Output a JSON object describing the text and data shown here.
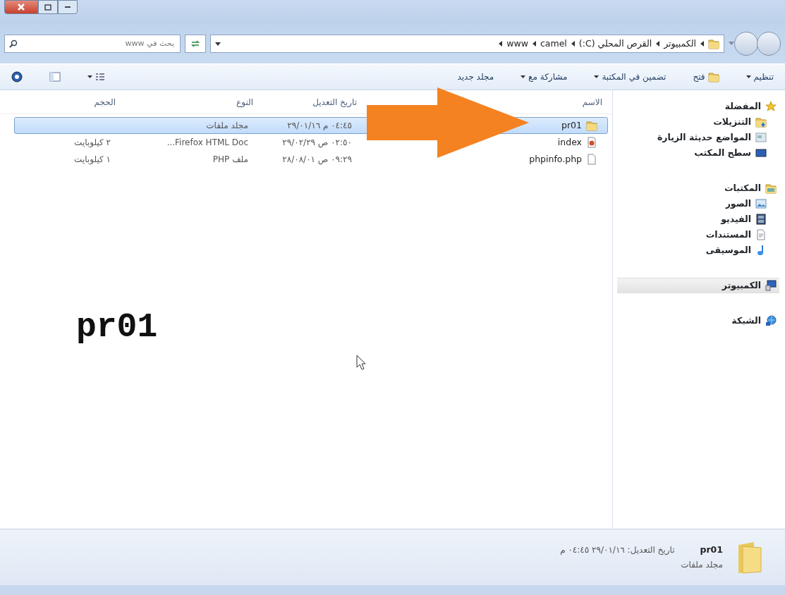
{
  "address": {
    "segments": [
      "الكمبيوتر",
      "القرص المحلي (C:)",
      "camel",
      "www"
    ]
  },
  "search": {
    "placeholder": "بحث في www"
  },
  "toolbar": [
    {
      "label": "تنظيم",
      "dropdown": true,
      "kind": "text"
    },
    {
      "label": "فتح",
      "dropdown": false,
      "kind": "folder"
    },
    {
      "label": "تضمين في المكتبة",
      "dropdown": true,
      "kind": "text"
    },
    {
      "label": "مشاركة مع",
      "dropdown": true,
      "kind": "text"
    },
    {
      "label": "مجلد جديد",
      "dropdown": false,
      "kind": "text"
    }
  ],
  "sidebar": [
    {
      "items": [
        {
          "label": "المفضلة",
          "kind": "star",
          "selected": false,
          "children": [
            {
              "label": "التنزيلات",
              "kind": "download",
              "selected": false
            },
            {
              "label": "المواضع حديثة الزيارة",
              "kind": "recent",
              "selected": false
            },
            {
              "label": "سطح المكتب",
              "kind": "desktop",
              "selected": false
            }
          ]
        }
      ]
    },
    {
      "items": [
        {
          "label": "المكتبات",
          "kind": "library",
          "selected": false,
          "children": [
            {
              "label": "الصور",
              "kind": "pictures",
              "selected": false
            },
            {
              "label": "الفيديو",
              "kind": "video",
              "selected": false
            },
            {
              "label": "المستندات",
              "kind": "documents",
              "selected": false
            },
            {
              "label": "الموسيقى",
              "kind": "music",
              "selected": false
            }
          ]
        }
      ]
    },
    {
      "items": [
        {
          "label": "الكمبيوتر",
          "kind": "computer",
          "selected": true
        }
      ]
    },
    {
      "items": [
        {
          "label": "الشبكة",
          "kind": "network",
          "selected": false
        }
      ]
    }
  ],
  "table": {
    "columns": [
      "الاسم",
      "تاريخ التعديل",
      "النوع",
      "الحجم"
    ],
    "rows": [
      {
        "name": "pr01",
        "kind": "folder",
        "modified": "٠٤:٤٥ م ٢٩/٠١/١٦",
        "type": "مجلد ملفات",
        "selected": true
      },
      {
        "name": "index",
        "kind": "html",
        "modified": "٠٢:٥٠ ص ٢٩/٠٢/٢٩",
        "type": "Firefox HTML Doc...",
        "size": "٢ كيلوبايت",
        "selected": false
      },
      {
        "name": "phpinfo.php",
        "kind": "file",
        "modified": "٠٩:٢٩ ص ٢٨/٠٨/٠١",
        "type": "ملف PHP",
        "size": "١ كيلوبايت",
        "selected": false
      }
    ]
  },
  "overlay_caption": "pr01",
  "status_bar": {
    "name": "pr01",
    "detail": "تاريخ التعديل: ٢٩/٠١/١٦ ٠٤:٤٥ م",
    "type": "مجلد ملفات"
  }
}
